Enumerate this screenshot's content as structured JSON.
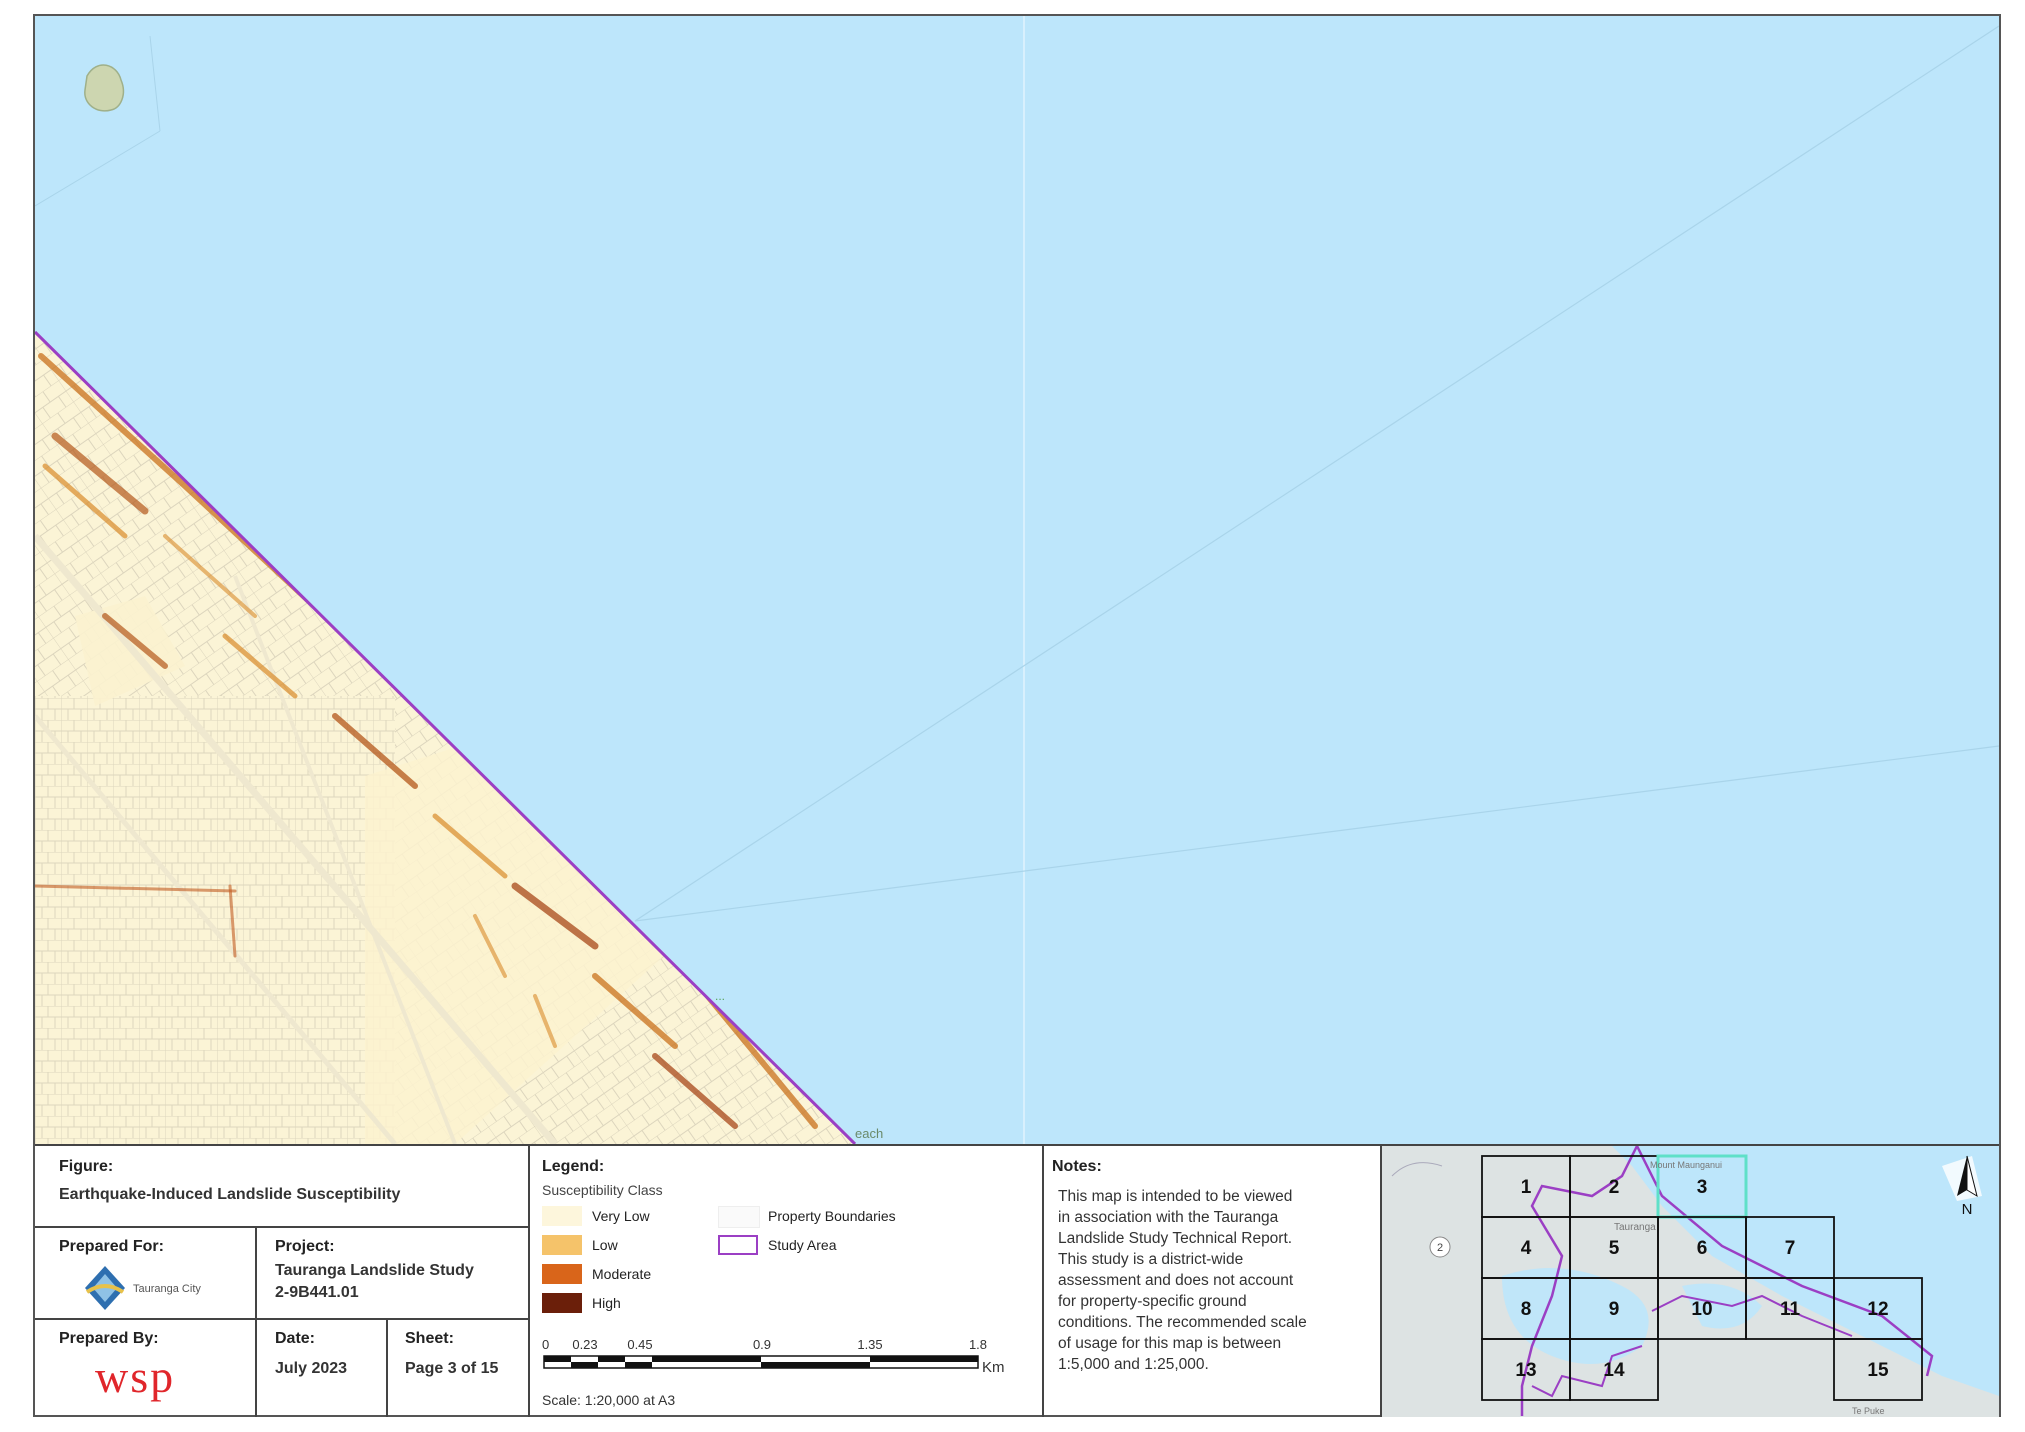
{
  "map": {
    "labels": {
      "coast_label": "...",
      "beach_label": "each"
    }
  },
  "figure": {
    "heading": "Figure:",
    "title": "Earthquake-Induced Landslide Susceptibility"
  },
  "prepared_for": {
    "heading": "Prepared For:",
    "logo_text": "Tauranga City"
  },
  "project": {
    "heading": "Project:",
    "name": "Tauranga Landslide Study",
    "number": "2-9B441.01"
  },
  "prepared_by": {
    "heading": "Prepared By:",
    "logo_text": "wsp",
    "logo_color": "#e0262b"
  },
  "date": {
    "heading": "Date:",
    "value": "July 2023"
  },
  "sheet": {
    "heading": "Sheet:",
    "value": "Page 3 of 15"
  },
  "legend": {
    "heading": "Legend:",
    "subheading": "Susceptibility Class",
    "classes": [
      {
        "label": "Very Low",
        "color": "#fdf6dc"
      },
      {
        "label": "Low",
        "color": "#f5c36a"
      },
      {
        "label": "Moderate",
        "color": "#d9651a"
      },
      {
        "label": "High",
        "color": "#6b1f0a"
      }
    ],
    "property_boundaries": "Property Boundaries",
    "study_area": "Study Area",
    "study_area_color": "#9b3fc4"
  },
  "scalebar": {
    "ticks": [
      "0",
      "0.23",
      "0.45",
      "0.9",
      "1.35",
      "1.8"
    ],
    "unit": "Km",
    "scale_text": "Scale: 1:20,000 at A3"
  },
  "notes": {
    "heading": "Notes:",
    "lines": [
      "This map is intended to be viewed",
      "in association with the Tauranga",
      "Landslide Study Technical Report.",
      "This study is a district-wide",
      "assessment and does not account",
      "for property-specific ground",
      "conditions. The recommended scale",
      "of usage for this map is between",
      "1:5,000 and 1:25,000."
    ]
  },
  "index_map": {
    "cells": [
      "1",
      "2",
      "3",
      "4",
      "5",
      "6",
      "7",
      "8",
      "9",
      "10",
      "11",
      "12",
      "13",
      "14",
      "15"
    ],
    "highlight_cell": "3",
    "highlight_color": "#5fe0c8",
    "route_label": "2",
    "north_label": "N",
    "place_labels": [
      "Mount Maunganui",
      "Tauranga",
      "Te Puke"
    ]
  }
}
